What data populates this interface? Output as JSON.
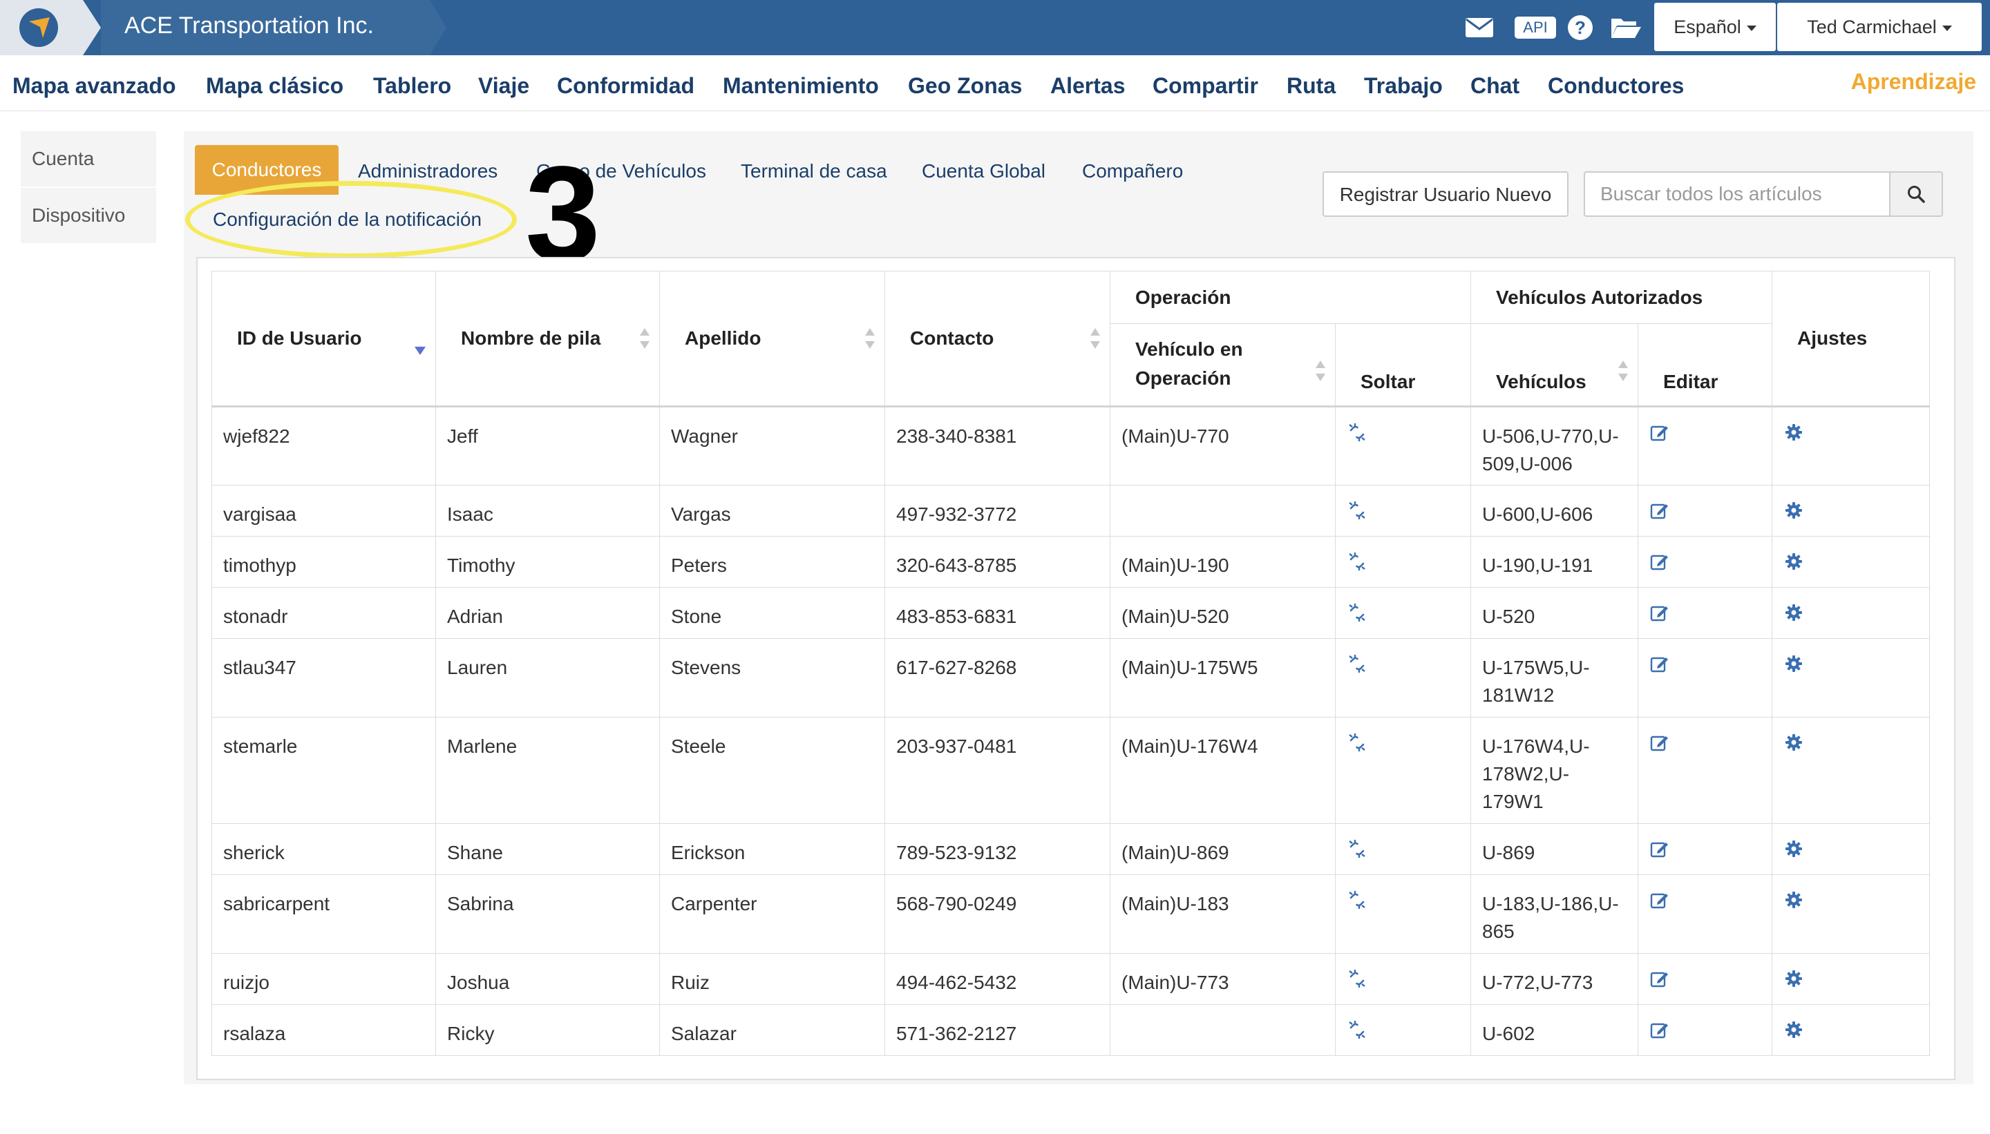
{
  "header": {
    "brand": "ACE Transportation Inc.",
    "api_label": "API",
    "language": "Español",
    "user": "Ted Carmichael",
    "colors": {
      "bar": "#2f6096",
      "accent": "#e8a639",
      "learn": "#f0a930"
    }
  },
  "nav": {
    "items": [
      "Mapa avanzado",
      "Mapa clásico",
      "Tablero",
      "Viaje",
      "Conformidad",
      "Mantenimiento",
      "Geo Zonas",
      "Alertas",
      "Compartir",
      "Ruta",
      "Trabajo",
      "Chat",
      "Conductores"
    ],
    "learn": "Aprendizaje"
  },
  "sidebar": {
    "items": [
      "Cuenta",
      "Dispositivo"
    ]
  },
  "tabs": {
    "active": "Conductores",
    "items": [
      "Administradores",
      "Grupo de Vehículos",
      "Terminal de casa",
      "Cuenta Global",
      "Compañero"
    ],
    "row2": "Configuración de la notificación"
  },
  "annotation": {
    "number": "3"
  },
  "actions": {
    "register": "Registrar Usuario Nuevo",
    "search_placeholder": "Buscar todos los artículos"
  },
  "table": {
    "headers": {
      "user_id": "ID de Usuario",
      "first": "Nombre de pila",
      "last": "Apellido",
      "contact": "Contacto",
      "operation": "Operación",
      "op_vehicle": "Vehículo en Operación",
      "release": "Soltar",
      "authorized": "Vehículos Autorizados",
      "vehicles": "Vehículos",
      "edit": "Editar",
      "settings": "Ajustes"
    },
    "rows": [
      {
        "id": "wjef822",
        "first": "Jeff",
        "last": "Wagner",
        "contact": "238-340-8381",
        "op": "(Main)U-770",
        "vehicles": "U-506,U-770,U-509,U-006"
      },
      {
        "id": "vargisaa",
        "first": "Isaac",
        "last": "Vargas",
        "contact": "497-932-3772",
        "op": "",
        "vehicles": "U-600,U-606"
      },
      {
        "id": "timothyp",
        "first": "Timothy",
        "last": "Peters",
        "contact": "320-643-8785",
        "op": "(Main)U-190",
        "vehicles": "U-190,U-191"
      },
      {
        "id": "stonadr",
        "first": "Adrian",
        "last": "Stone",
        "contact": "483-853-6831",
        "op": "(Main)U-520",
        "vehicles": "U-520"
      },
      {
        "id": "stlau347",
        "first": "Lauren",
        "last": "Stevens",
        "contact": "617-627-8268",
        "op": "(Main)U-175W5",
        "vehicles": "U-175W5,U-181W12"
      },
      {
        "id": "stemarle",
        "first": "Marlene",
        "last": "Steele",
        "contact": "203-937-0481",
        "op": "(Main)U-176W4",
        "vehicles": "U-176W4,U-178W2,U-179W1"
      },
      {
        "id": "sherick",
        "first": "Shane",
        "last": "Erickson",
        "contact": "789-523-9132",
        "op": "(Main)U-869",
        "vehicles": "U-869"
      },
      {
        "id": "sabricarpent",
        "first": "Sabrina",
        "last": "Carpenter",
        "contact": "568-790-0249",
        "op": "(Main)U-183",
        "vehicles": "U-183,U-186,U-865"
      },
      {
        "id": "ruizjo",
        "first": "Joshua",
        "last": "Ruiz",
        "contact": "494-462-5432",
        "op": "(Main)U-773",
        "vehicles": "U-772,U-773"
      },
      {
        "id": "rsalaza",
        "first": "Ricky",
        "last": "Salazar",
        "contact": "571-362-2127",
        "op": "",
        "vehicles": "U-602"
      }
    ]
  }
}
